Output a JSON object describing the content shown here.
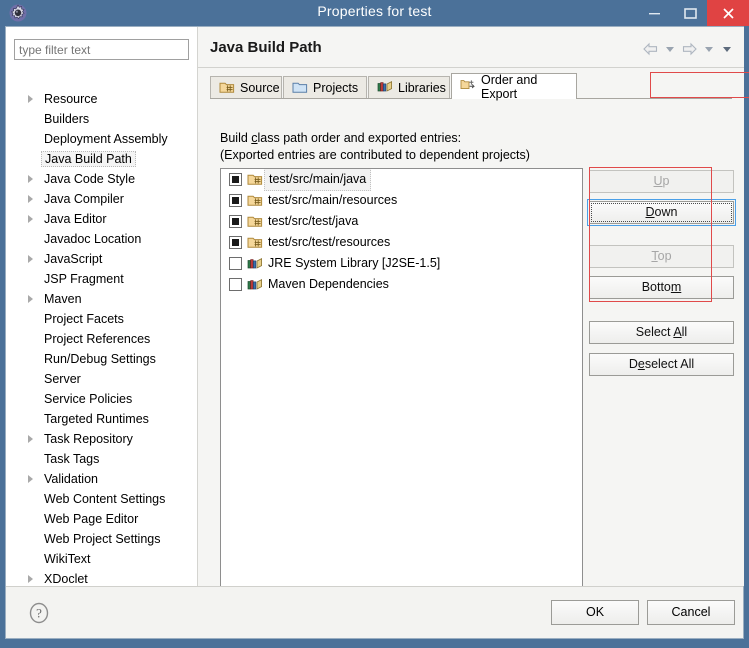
{
  "window": {
    "title": "Properties for test",
    "icon": "gear-icon",
    "controls": {
      "minimize": "–",
      "maximize": "❐",
      "close": "✕"
    }
  },
  "sidebar": {
    "filter_placeholder": "type filter text",
    "filter_value": "",
    "items": [
      {
        "label": "Resource",
        "expandable": true,
        "selected": false
      },
      {
        "label": "Builders",
        "expandable": false,
        "selected": false
      },
      {
        "label": "Deployment Assembly",
        "expandable": false,
        "selected": false
      },
      {
        "label": "Java Build Path",
        "expandable": false,
        "selected": true
      },
      {
        "label": "Java Code Style",
        "expandable": true,
        "selected": false
      },
      {
        "label": "Java Compiler",
        "expandable": true,
        "selected": false
      },
      {
        "label": "Java Editor",
        "expandable": true,
        "selected": false
      },
      {
        "label": "Javadoc Location",
        "expandable": false,
        "selected": false
      },
      {
        "label": "JavaScript",
        "expandable": true,
        "selected": false
      },
      {
        "label": "JSP Fragment",
        "expandable": false,
        "selected": false
      },
      {
        "label": "Maven",
        "expandable": true,
        "selected": false
      },
      {
        "label": "Project Facets",
        "expandable": false,
        "selected": false
      },
      {
        "label": "Project References",
        "expandable": false,
        "selected": false
      },
      {
        "label": "Run/Debug Settings",
        "expandable": false,
        "selected": false
      },
      {
        "label": "Server",
        "expandable": false,
        "selected": false
      },
      {
        "label": "Service Policies",
        "expandable": false,
        "selected": false
      },
      {
        "label": "Targeted Runtimes",
        "expandable": false,
        "selected": false
      },
      {
        "label": "Task Repository",
        "expandable": true,
        "selected": false
      },
      {
        "label": "Task Tags",
        "expandable": false,
        "selected": false
      },
      {
        "label": "Validation",
        "expandable": true,
        "selected": false
      },
      {
        "label": "Web Content Settings",
        "expandable": false,
        "selected": false
      },
      {
        "label": "Web Page Editor",
        "expandable": false,
        "selected": false
      },
      {
        "label": "Web Project Settings",
        "expandable": false,
        "selected": false
      },
      {
        "label": "WikiText",
        "expandable": false,
        "selected": false
      },
      {
        "label": "XDoclet",
        "expandable": true,
        "selected": false
      }
    ]
  },
  "page": {
    "title": "Java Build Path",
    "nav": {
      "back": "back-arrow",
      "back_menu": "chevron-down-icon",
      "forward": "forward-arrow",
      "forward_menu": "chevron-down-icon",
      "view_menu": "chevron-down-icon"
    },
    "tabs": [
      {
        "label": "Source",
        "icon": "source-folder-icon",
        "active": false
      },
      {
        "label": "Projects",
        "icon": "projects-folder-icon",
        "active": false
      },
      {
        "label": "Libraries",
        "icon": "libraries-icon",
        "active": false
      },
      {
        "label": "Order and Export",
        "icon": "order-export-icon",
        "active": true
      }
    ],
    "description_line1": "Build class path order and exported entries:",
    "description_line1_mnemonic": "c",
    "description_line2": "(Exported entries are contributed to dependent projects)",
    "entries": [
      {
        "label": "test/src/main/java",
        "icon": "source-folder-icon",
        "checked": true,
        "selected": true
      },
      {
        "label": "test/src/main/resources",
        "icon": "source-folder-icon",
        "checked": true,
        "selected": false
      },
      {
        "label": "test/src/test/java",
        "icon": "source-folder-icon",
        "checked": true,
        "selected": false
      },
      {
        "label": "test/src/test/resources",
        "icon": "source-folder-icon",
        "checked": true,
        "selected": false
      },
      {
        "label": "JRE System Library [J2SE-1.5]",
        "icon": "library-icon",
        "checked": false,
        "selected": false
      },
      {
        "label": "Maven Dependencies",
        "icon": "library-icon",
        "checked": false,
        "selected": false
      }
    ],
    "buttons": [
      {
        "id": "up",
        "label": "Up",
        "mnemonic": "U",
        "state": "disabled"
      },
      {
        "id": "down",
        "label": "Down",
        "mnemonic": "D",
        "state": "focused"
      },
      {
        "id": "top",
        "label": "Top",
        "mnemonic": "T",
        "state": "disabled"
      },
      {
        "id": "bottom",
        "label": "Bottom",
        "mnemonic": "m",
        "state": "enabled"
      },
      {
        "id": "select_all",
        "label": "Select All",
        "mnemonic": "A",
        "state": "enabled"
      },
      {
        "id": "deselect_all",
        "label": "Deselect All",
        "mnemonic": "e",
        "state": "enabled"
      }
    ]
  },
  "footer": {
    "help": "help-icon",
    "ok_label": "OK",
    "cancel_label": "Cancel"
  },
  "annotations": {
    "highlight_color": "#e04a4a",
    "regions": [
      "order-and-export-tab",
      "move-buttons-group"
    ]
  },
  "colors": {
    "titlebar": "#4b7199",
    "close_button": "#e04343",
    "dialog_background": "#f3f3f1",
    "accent_focus": "#4ba0e8",
    "annotation_red": "#e04a4a"
  }
}
